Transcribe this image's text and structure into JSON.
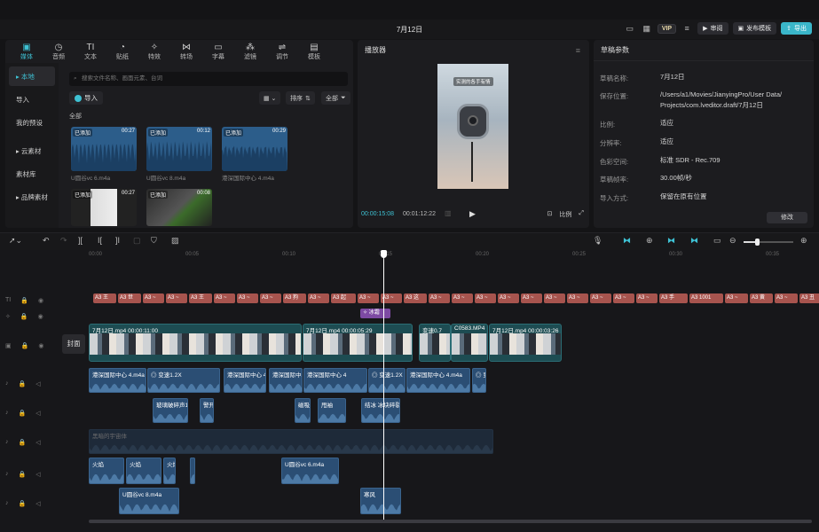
{
  "window": {
    "title": "7月12日"
  },
  "topbar": {
    "review": "审阅",
    "publish": "发布模板",
    "export": "导出",
    "vip": "VIP"
  },
  "media": {
    "tabs": [
      {
        "label": "媒体",
        "icon": "media-icon",
        "glyph": "▣",
        "active": true
      },
      {
        "label": "音频",
        "icon": "audio-icon",
        "glyph": "◷"
      },
      {
        "label": "文本",
        "icon": "text-icon",
        "glyph": "TI"
      },
      {
        "label": "贴纸",
        "icon": "sticker-icon",
        "glyph": "◔"
      },
      {
        "label": "特效",
        "icon": "effects-icon",
        "glyph": "✧"
      },
      {
        "label": "转场",
        "icon": "transition-icon",
        "glyph": "⋈"
      },
      {
        "label": "字幕",
        "icon": "caption-icon",
        "glyph": "▭"
      },
      {
        "label": "滤镜",
        "icon": "filter-icon",
        "glyph": "⁂"
      },
      {
        "label": "调节",
        "icon": "adjust-icon",
        "glyph": "⇌"
      },
      {
        "label": "模板",
        "icon": "template-icon",
        "glyph": "▤"
      }
    ],
    "sidebar": [
      "▸ 本地",
      "导入",
      "我的预设",
      "▸ 云素材",
      "素材库",
      "▸ 品牌素材"
    ],
    "search_placeholder": "搜索文件名称、画面元素、台词",
    "import_label": "导入",
    "sort_label": "排序",
    "all_filter": "全部",
    "all_label": "全部",
    "items": [
      {
        "tag": "已添加",
        "dur": "00:27",
        "name": "U圆谷vc 6.m4a"
      },
      {
        "tag": "已添加",
        "dur": "00:12",
        "name": "U圆谷vc 8.m4a"
      },
      {
        "tag": "已添加",
        "dur": "00:29",
        "name": "港深国际中心 4.m4a"
      },
      {
        "tag": "已添加",
        "dur": "00:27",
        "name": ""
      },
      {
        "tag": "已添加",
        "dur": "00:08",
        "name": ""
      }
    ]
  },
  "player": {
    "title": "播放器",
    "current": "00:00:15:08",
    "total": "00:01:12:22",
    "ratio": "比例",
    "caption": "实测的各手有情",
    "accent": "#3ec1d3"
  },
  "draft": {
    "title": "草稿参数",
    "rows": [
      {
        "k": "草稿名称:",
        "v": "7月12日"
      },
      {
        "k": "保存位置:",
        "v": "/Users/a1/Movies/JianyingPro/User Data/ Projects/com.lveditor.draft/7月12日"
      },
      {
        "k": "比例:",
        "v": "适应"
      },
      {
        "k": "分辨率:",
        "v": "适应"
      },
      {
        "k": "色彩空间:",
        "v": "标准 SDR - Rec.709"
      },
      {
        "k": "草稿帧率:",
        "v": "30.00帧/秒"
      },
      {
        "k": "导入方式:",
        "v": "保留在原有位置"
      }
    ],
    "edit": "修改"
  },
  "timeline": {
    "ticks": [
      "00:00",
      "00:05",
      "00:10",
      "00:15",
      "00:20",
      "00:25",
      "00:30",
      "00:35"
    ],
    "cover": "封面",
    "fx": "冰霜",
    "text_clips": [
      "A3 王",
      "A3 世",
      "A3 ~",
      "A3 ~",
      "A3 王",
      "A3 ~",
      "A3 ~",
      "A3 ~",
      "A3 狗",
      "A3 ~",
      "A3 起",
      "A3 ~",
      "A3 ~",
      "A3 这",
      "A3 ~",
      "A3 ~",
      "A3 ~",
      "A3 ~",
      "A3 ~",
      "A3 ~",
      "A3 ~",
      "A3 ~",
      "A3 ~",
      "A3 ~",
      "A3 手",
      "A3 1001",
      "A3 ~",
      "A3 黄",
      "A3 ~",
      "A3 丑"
    ],
    "video_clips": [
      {
        "label": "7月12日.mp4  00:00:11:00"
      },
      {
        "label": "7月12日.mp4  00:00:05:29"
      },
      {
        "label": "变速0.7"
      },
      {
        "label": "C0583.MP4"
      },
      {
        "label": "7月12日.mp4  00:00:03:26"
      }
    ],
    "audio1": [
      "港深国际中心 4.m4a",
      "◎ 变速1.2X",
      "港深国际中心 4.m4a",
      "港深国际中心 4.",
      "港深国际中心 4",
      "◎ 变速1.2X",
      "港深国际中心 4.m4a",
      "◎ 变速"
    ],
    "audio2": [
      "玻璃破碎声1",
      "警开",
      "磁吸",
      "甩袖",
      "结冰 冰块碎裂"
    ],
    "audio3": "黑暗的宇宙体",
    "audio4": [
      "火焰",
      "火焰",
      "火焰",
      "旋风",
      "U圆谷vc 6.m4a"
    ],
    "audio5": [
      "U圆谷vc 8.m4a",
      "寒风"
    ]
  }
}
